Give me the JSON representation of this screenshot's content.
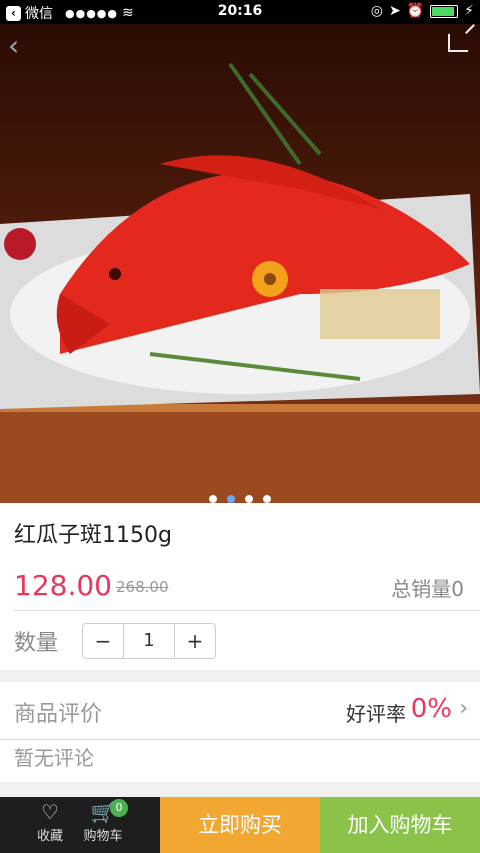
{
  "status_bar": {
    "carrier": "微信",
    "signal": "●●●●●",
    "time": "20:16",
    "back_icon": "back-badge-icon"
  },
  "hero": {
    "image_description": "red grouper fish on ice platter",
    "slide_count": 4,
    "active_slide": 2
  },
  "product": {
    "title": "红瓜子斑1150g",
    "price": "128.00",
    "old_price": "268.00",
    "sales": "总销量0",
    "quantity_label": "数量",
    "quantity_value": "1",
    "minus": "−",
    "plus": "+"
  },
  "reviews": {
    "label": "商品评价",
    "rate_label": "好评率",
    "rate_value": "0%",
    "empty_text": "暂无评论"
  },
  "bottom": {
    "favorite_label": "收藏",
    "cart_label": "购物车",
    "cart_badge": "0",
    "buy_now": "立即购买",
    "add_cart": "加入购物车"
  },
  "colors": {
    "price": "#e8375a",
    "buy_now_bg": "#f2a830",
    "add_cart_bg": "#8bc34a",
    "bottom_icons_bg": "#1e1e1e",
    "active_dot": "#6aa8ff"
  }
}
